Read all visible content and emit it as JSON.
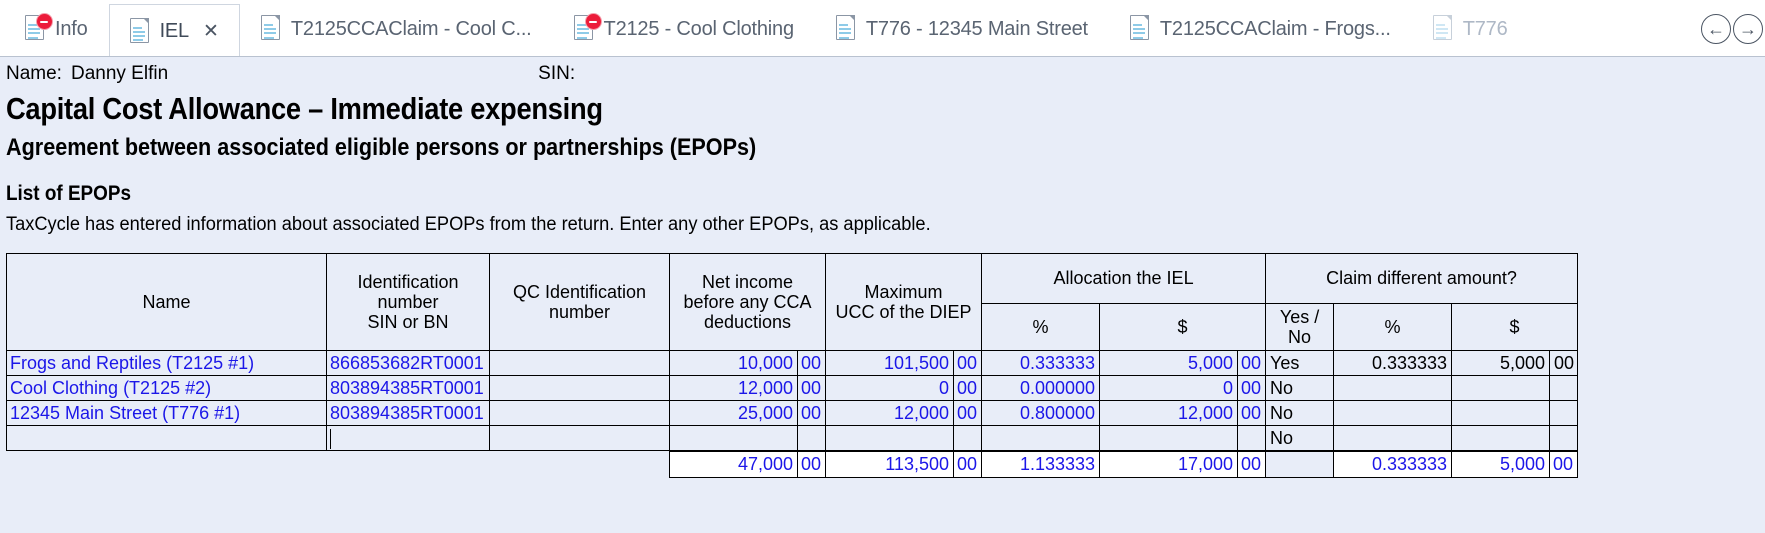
{
  "tabs": [
    {
      "label": "Info",
      "icon": "document-icon",
      "error": true,
      "active": false,
      "dim": false,
      "closeable": false
    },
    {
      "label": "IEL",
      "icon": "document-icon",
      "error": false,
      "active": true,
      "dim": false,
      "closeable": true,
      "close_label": "✕"
    },
    {
      "label": "T2125CCAClaim - Cool C...",
      "icon": "document-icon",
      "error": false,
      "active": false,
      "dim": false,
      "closeable": false
    },
    {
      "label": "T2125 - Cool Clothing",
      "icon": "document-icon",
      "error": true,
      "active": false,
      "dim": false,
      "closeable": false
    },
    {
      "label": "T776 - 12345 Main Street",
      "icon": "document-icon",
      "error": false,
      "active": false,
      "dim": false,
      "closeable": false
    },
    {
      "label": "T2125CCAClaim - Frogs...",
      "icon": "document-icon",
      "error": false,
      "active": false,
      "dim": false,
      "closeable": false
    },
    {
      "label": "T776",
      "icon": "document-icon",
      "error": false,
      "active": false,
      "dim": true,
      "closeable": false
    }
  ],
  "nav": {
    "back_icon": "arrow-left-circle-icon",
    "back_glyph": "←",
    "forward_icon": "arrow-right-circle-icon",
    "forward_glyph": "→"
  },
  "header": {
    "name_label": "Name:",
    "name_value": "Danny Elfin",
    "sin_label": "SIN:",
    "sin_value": "",
    "title": "Capital Cost Allowance – Immediate expensing",
    "subtitle": "Agreement between associated eligible persons or partnerships (EPOPs)",
    "section_title": "List of EPOPs",
    "hint": "TaxCycle has entered information about associated EPOPs from the return. Enter any other EPOPs, as applicable."
  },
  "table": {
    "headers": {
      "name": "Name",
      "id_number_l1": "Identification",
      "id_number_l2": "number",
      "id_number_l3": "SIN or BN",
      "qc_id_l1": "QC Identification",
      "qc_id_l2": "number",
      "net_income_l1": "Net income",
      "net_income_l2": "before any CCA",
      "net_income_l3": "deductions",
      "max_ucc_l1": "Maximum",
      "max_ucc_l2": "UCC of the DIEP",
      "allocation_group": "Allocation the IEL",
      "claim_group": "Claim different amount?",
      "pct": "%",
      "dollar": "$",
      "yes_no": "Yes / No",
      "claim_pct": "%",
      "claim_dollar": "$"
    },
    "rows": [
      {
        "name": "Frogs and Reptiles (T2125 #1)",
        "id_number": "866853682RT0001",
        "qc_id": "",
        "net_income": "10,000",
        "net_income_cents": "00",
        "max_ucc": "101,500",
        "max_ucc_cents": "00",
        "alloc_pct": "0.333333",
        "alloc_amt": "5,000",
        "alloc_amt_cents": "00",
        "yes_no": "Yes",
        "claim_pct": "0.333333",
        "claim_amt": "5,000",
        "claim_amt_cents": "00"
      },
      {
        "name": "Cool Clothing (T2125 #2)",
        "id_number": "803894385RT0001",
        "qc_id": "",
        "net_income": "12,000",
        "net_income_cents": "00",
        "max_ucc": "0",
        "max_ucc_cents": "00",
        "alloc_pct": "0.000000",
        "alloc_amt": "0",
        "alloc_amt_cents": "00",
        "yes_no": "No",
        "claim_pct": "",
        "claim_amt": "",
        "claim_amt_cents": ""
      },
      {
        "name": "12345 Main Street (T776 #1)",
        "id_number": "803894385RT0001",
        "qc_id": "",
        "net_income": "25,000",
        "net_income_cents": "00",
        "max_ucc": "12,000",
        "max_ucc_cents": "00",
        "alloc_pct": "0.800000",
        "alloc_amt": "12,000",
        "alloc_amt_cents": "00",
        "yes_no": "No",
        "claim_pct": "",
        "claim_amt": "",
        "claim_amt_cents": ""
      },
      {
        "name": "",
        "id_number": "",
        "qc_id": "",
        "net_income": "",
        "net_income_cents": "",
        "max_ucc": "",
        "max_ucc_cents": "",
        "alloc_pct": "",
        "alloc_amt": "",
        "alloc_amt_cents": "",
        "yes_no": "No",
        "claim_pct": "",
        "claim_amt": "",
        "claim_amt_cents": ""
      }
    ],
    "totals": {
      "net_income": "47,000",
      "net_income_cents": "00",
      "max_ucc": "113,500",
      "max_ucc_cents": "00",
      "alloc_pct": "1.133333",
      "alloc_amt": "17,000",
      "alloc_amt_cents": "00",
      "yes_no": "",
      "claim_pct": "0.333333",
      "claim_amt": "5,000",
      "claim_amt_cents": "00"
    }
  },
  "colors": {
    "field_text": "#1b16e8",
    "form_background": "#e8edf8",
    "cell_background": "#ffffff",
    "error_badge": "#ec1c3a",
    "icon_blue": "#8ecbe8"
  }
}
